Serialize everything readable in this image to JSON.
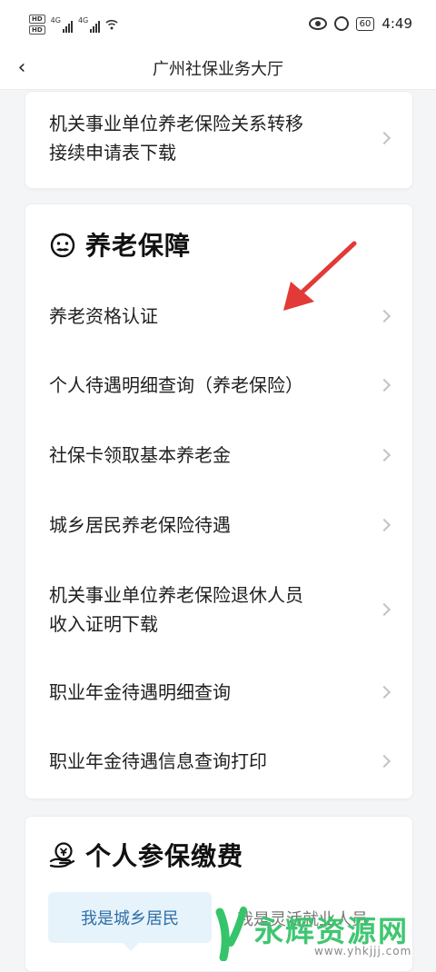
{
  "status_bar": {
    "hd_badges": [
      "HD",
      "HD"
    ],
    "net_badges": [
      "4G",
      "4G"
    ],
    "battery": "60",
    "time": "4:49"
  },
  "navbar": {
    "back_glyph": "‹",
    "title": "广州社保业务大厅"
  },
  "top_card": {
    "item": {
      "line1": "机关事业单位养老保险关系转移",
      "line2": "接续申请表下载"
    }
  },
  "pension_card": {
    "title": "养老保障",
    "items": [
      {
        "line1": "养老资格认证"
      },
      {
        "line1": "个人待遇明细查询（养老保险）"
      },
      {
        "line1": "社保卡领取基本养老金"
      },
      {
        "line1": "城乡居民养老保险待遇"
      },
      {
        "line1": "机关事业单位养老保险退休人员",
        "line2": "收入证明下载"
      },
      {
        "line1": "职业年金待遇明细查询"
      },
      {
        "line1": "职业年金待遇信息查询打印"
      }
    ]
  },
  "contribution_card": {
    "title": "个人参保缴费",
    "tabs": {
      "active": "我是城乡居民",
      "other": "我是灵活就业人员"
    }
  },
  "watermark": {
    "text": "永辉资源网",
    "url": "www.yhkjjj.com"
  },
  "colors": {
    "accent_blue": "#2f6fa8",
    "tab_bg": "#e6f3fb",
    "arrow_red": "#e23a37",
    "watermark_green": "#36c46a"
  }
}
